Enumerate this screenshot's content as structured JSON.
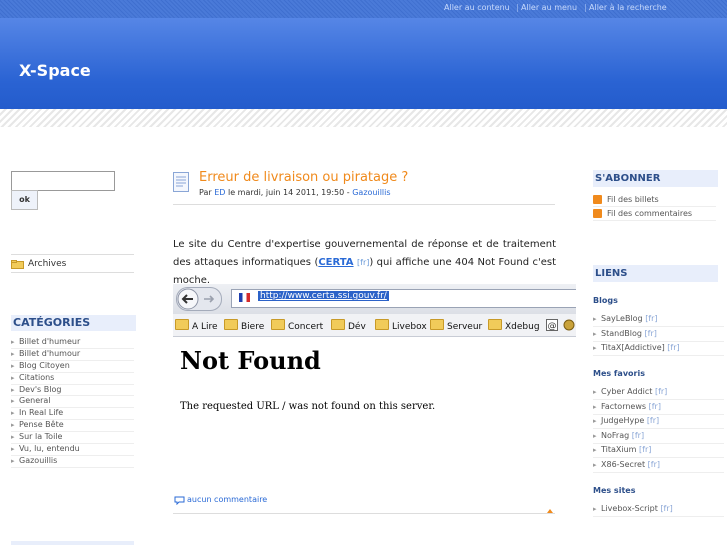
{
  "skip_links": [
    "Aller au contenu",
    "Aller au menu",
    "Aller à la recherche"
  ],
  "site_title": "X-Space",
  "search": {
    "value": "",
    "button_label": "ok"
  },
  "archives_label": "Archives",
  "categories": {
    "title": "CATÉGORIES",
    "items": [
      "Billet d'humeur",
      "Billet d'humour",
      "Blog Citoyen",
      "Citations",
      "Dev's Blog",
      "General",
      "In Real Life",
      "Pense Bête",
      "Sur la Toile",
      "Vu, lu, entendu",
      "Gazouillis"
    ]
  },
  "post": {
    "title": "Erreur de livraison ou piratage ?",
    "meta_by": "Par",
    "meta_author": "ED",
    "meta_date": "le mardi, juin 14 2011, 19:50 -",
    "meta_category": "Gazouillis",
    "body_part1": "Le site du Centre d'expertise gouvernemental de réponse et de traitement des attaques informatiques (",
    "certa": "CERTA",
    "certa_lang": "[fr]",
    "body_part2": ") qui affiche une 404 Not Found c'est moche.",
    "comment_link": "aucun commentaire"
  },
  "screenshot": {
    "url": "http://www.certa.ssi.gouv.fr/",
    "bookmarks": [
      "A Lire",
      "Biere",
      "Concert",
      "Dév",
      "Livebox",
      "Serveur",
      "Xdebug"
    ],
    "heading": "Not Found",
    "message": "The requested URL / was not found on this server."
  },
  "subscribe": {
    "title": "S'ABONNER",
    "feeds": [
      "Fil des billets",
      "Fil des commentaires"
    ]
  },
  "links": {
    "title": "LIENS",
    "lang_tag": "[fr]",
    "blogs_label": "Blogs",
    "blogs": [
      "SayLeBlog",
      "StandBlog",
      "TitaX[Addictive]"
    ],
    "favorites_label": "Mes favoris",
    "favorites": [
      "Cyber Addict",
      "Factornews",
      "JudgeHype",
      "NoFrag",
      "TitaXium",
      "X86-Secret"
    ],
    "sites_label": "Mes sites",
    "sites": [
      "Livebox-Script"
    ]
  },
  "colors": {
    "banner": "#2a63d3",
    "accent": "#f08a1c",
    "link": "#2a6ad6",
    "heading": "#2d4f8a"
  }
}
